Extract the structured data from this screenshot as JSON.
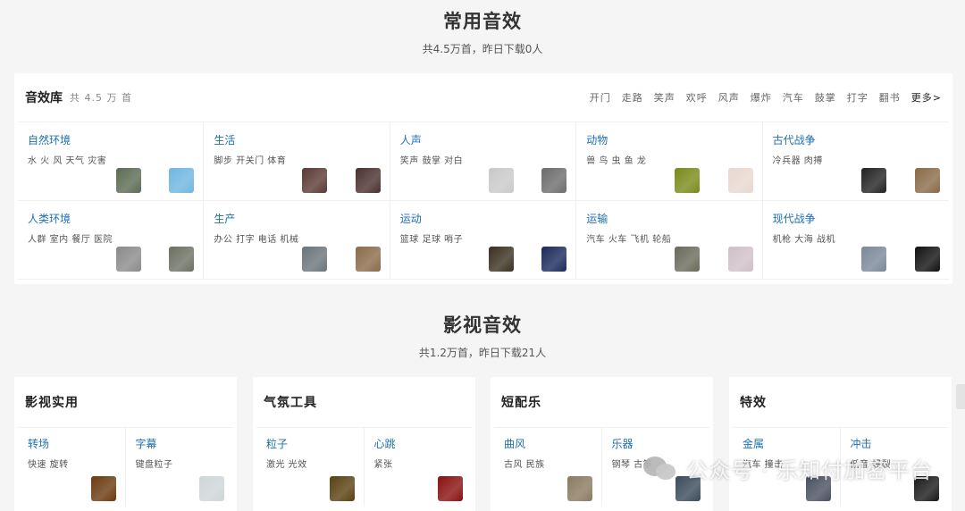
{
  "common": {
    "title": "常用音效",
    "stats": "共4.5万首，昨日下载0人",
    "library_name": "音效库",
    "library_count": "共 4.5 万 首",
    "tags": [
      "开门",
      "走路",
      "笑声",
      "欢呼",
      "风声",
      "爆炸",
      "汽车",
      "鼓掌",
      "打字",
      "翻书"
    ],
    "more": "更多>",
    "categories": [
      {
        "title": "自然环境",
        "desc": "水 火 风 天气 灾害",
        "thumbs": [
          "#5b6b52",
          "#6fb6e0"
        ]
      },
      {
        "title": "生活",
        "desc": "脚步 开关门 体育",
        "thumbs": [
          "#5a3a33",
          "#4a3030"
        ]
      },
      {
        "title": "人声",
        "desc": "笑声 鼓掌 对白",
        "thumbs": [
          "#c9c9c9",
          "#6c6c6c"
        ]
      },
      {
        "title": "动物",
        "desc": "兽 鸟 虫 鱼 龙",
        "thumbs": [
          "#7a8a1a",
          "#e8d8d0"
        ]
      },
      {
        "title": "古代战争",
        "desc": "冷兵器 肉搏",
        "thumbs": [
          "#222222",
          "#8a6a48"
        ]
      },
      {
        "title": "人类环境",
        "desc": "人群 室内 餐厅 医院",
        "thumbs": [
          "#8a8a8a",
          "#6c7062"
        ]
      },
      {
        "title": "生产",
        "desc": "办公 打字 电话 机械",
        "thumbs": [
          "#6a747a",
          "#8a6a4a"
        ]
      },
      {
        "title": "运动",
        "desc": "篮球 足球 哨子",
        "thumbs": [
          "#3a3020",
          "#1a2a5a"
        ]
      },
      {
        "title": "运输",
        "desc": "汽车 火车 飞机 轮船",
        "thumbs": [
          "#6a6a5a",
          "#d0c0c8"
        ]
      },
      {
        "title": "现代战争",
        "desc": "机枪 大海 战机",
        "thumbs": [
          "#7a8898",
          "#111111"
        ]
      }
    ]
  },
  "film": {
    "title": "影视音效",
    "stats": "共1.2万首，昨日下载21人",
    "cards": [
      {
        "title": "影视实用",
        "items": [
          {
            "title": "转场",
            "desc": "快速 旋转",
            "thumb": "#6a3a10"
          },
          {
            "title": "字幕",
            "desc": "键盘粒子",
            "thumb": "#cfd6d8"
          }
        ]
      },
      {
        "title": "气氛工具",
        "items": [
          {
            "title": "粒子",
            "desc": "激光 光效",
            "thumb": "#5a4010"
          },
          {
            "title": "心跳",
            "desc": "紧张",
            "thumb": "#8a1010"
          }
        ]
      },
      {
        "title": "短配乐",
        "items": [
          {
            "title": "曲风",
            "desc": "古风 民族",
            "thumb": "#8a7a60"
          },
          {
            "title": "乐器",
            "desc": "钢琴 古筝",
            "thumb": "#3a4a5a"
          }
        ]
      },
      {
        "title": "特效",
        "items": [
          {
            "title": "金属",
            "desc": "汽车 撞击",
            "thumb": "#4a5060"
          },
          {
            "title": "冲击",
            "desc": "低音 爆裂",
            "thumb": "#1a1a1a"
          }
        ]
      }
    ]
  },
  "watermark": {
    "text": "公众号 · 乐知付加密平台"
  }
}
